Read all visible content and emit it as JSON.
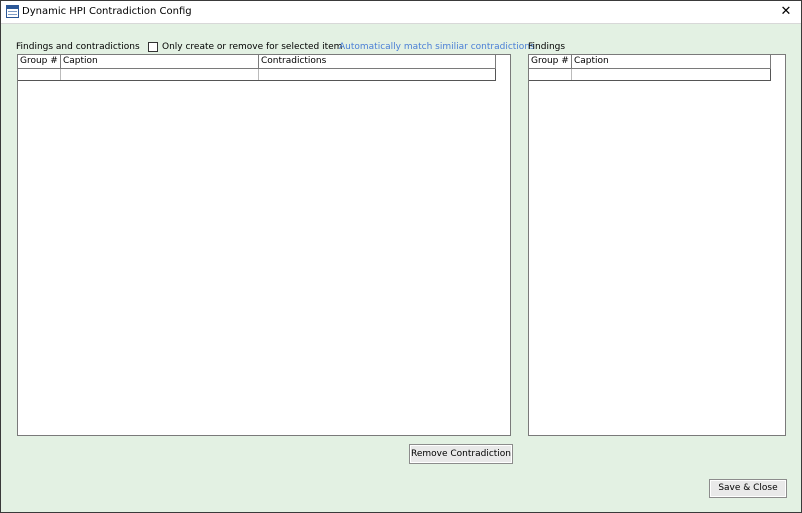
{
  "window": {
    "title": "Dynamic HPI Contradiction Config",
    "close_label": "✕"
  },
  "left_section": {
    "label": "Findings and contradictions",
    "checkbox_label": "Only create or remove for selected item",
    "checkbox_checked": false,
    "link_label": "Automatically match similiar contradictions",
    "columns": [
      "Group #",
      "Caption",
      "Contradictions"
    ]
  },
  "right_section": {
    "label": "Findings",
    "columns": [
      "Group #",
      "Caption"
    ]
  },
  "buttons": {
    "remove_contradiction": "Remove Contradiction",
    "save_close": "Save & Close"
  },
  "colors": {
    "background": "#e3f1e3",
    "link": "#4a7fd6"
  }
}
